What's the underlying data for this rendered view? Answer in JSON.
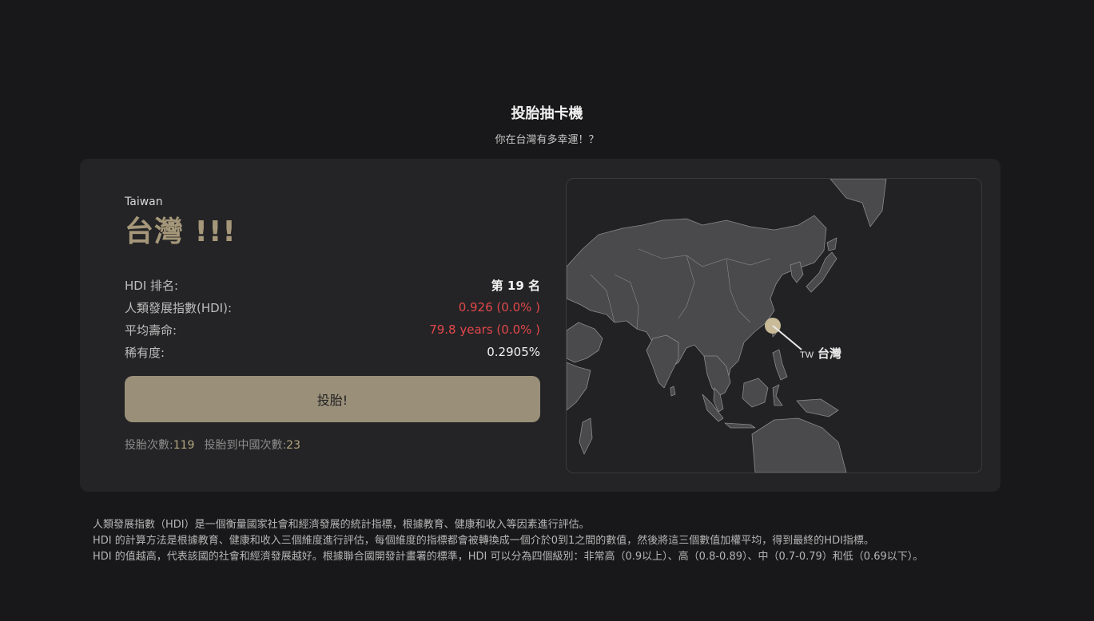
{
  "header": {
    "title": "投胎抽卡機",
    "subtitle": "你在台灣有多幸運！？"
  },
  "result": {
    "country_en": "Taiwan",
    "country_zh": "台灣 !!!",
    "stats": [
      {
        "label": "HDI 排名:",
        "value": "第 19 名"
      },
      {
        "label": "人類發展指數(HDI):",
        "value": "0.926 (0.0% )"
      },
      {
        "label": "平均壽命:",
        "value": "79.8 years (0.0% )"
      },
      {
        "label": "稀有度:",
        "value": "0.2905%"
      }
    ],
    "roll_button": "投胎!",
    "counts": {
      "roll_label": "投胎次數:",
      "roll_value": "119",
      "china_label": "投胎到中國次數:",
      "china_value": "23"
    }
  },
  "map": {
    "marker_code": "TW",
    "marker_name": "台灣",
    "land_color": "#4a4a4c",
    "marker_color": "#c9bb98"
  },
  "footer": {
    "lines": [
      "人類發展指數（HDI）是一個衡量國家社會和經濟發展的統計指標，根據教育、健康和收入等因素進行評估。",
      "HDI 的計算方法是根據教育、健康和收入三個維度進行評估，每個維度的指標都會被轉換成一個介於0到1之間的數值，然後將這三個數值加權平均，得到最終的HDI指標。",
      "HDI 的值越高，代表該國的社會和經濟發展越好。根據聯合國開發計畫署的標準，HDI 可以分為四個級別：非常高（0.9以上）、高（0.8-0.89）、中（0.7-0.79）和低（0.69以下）。"
    ]
  }
}
